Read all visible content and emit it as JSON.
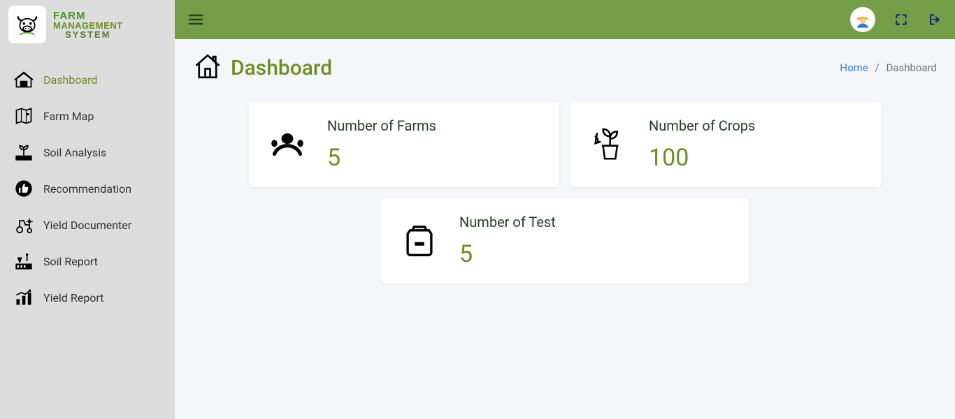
{
  "brand": {
    "line1": "FARM",
    "line2": "MANAGEMENT",
    "line3": "SYSTEM"
  },
  "sidebar": {
    "items": [
      {
        "label": "Dashboard",
        "active": true
      },
      {
        "label": "Farm Map"
      },
      {
        "label": "Soil Analysis"
      },
      {
        "label": "Recommendation"
      },
      {
        "label": "Yield Documenter"
      },
      {
        "label": "Soil Report"
      },
      {
        "label": "Yield Report"
      }
    ]
  },
  "page": {
    "title": "Dashboard",
    "breadcrumb": {
      "home": "Home",
      "current": "Dashboard",
      "sep": "/"
    }
  },
  "cards": {
    "farms": {
      "label": "Number of Farms",
      "value": "5"
    },
    "crops": {
      "label": "Number of Crops",
      "value": "100"
    },
    "tests": {
      "label": "Number of Test",
      "value": "5"
    }
  },
  "colors": {
    "accent": "#6b8e23",
    "header": "#759e48",
    "link": "#2e86de"
  }
}
